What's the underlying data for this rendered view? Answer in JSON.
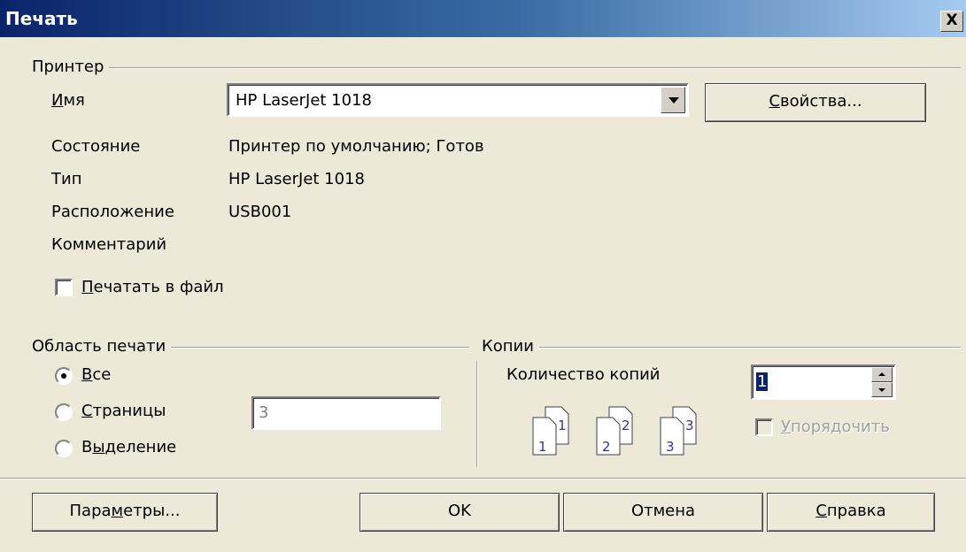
{
  "window": {
    "title": "Печать",
    "close_glyph": "X"
  },
  "printer": {
    "group_label": "Принтер",
    "name_label": "Имя",
    "name_value": "HP LaserJet 1018",
    "properties_button": "Свойства...",
    "status_label": "Состояние",
    "status_value": "Принтер по умолчанию; Готов",
    "type_label": "Тип",
    "type_value": "HP LaserJet 1018",
    "location_label": "Расположение",
    "location_value": "USB001",
    "comment_label": "Комментарий",
    "comment_value": "",
    "print_to_file_label": "Печатать в файл",
    "print_to_file_checked": false
  },
  "print_range": {
    "group_label": "Область печати",
    "options": [
      {
        "label": "Все",
        "selected": true
      },
      {
        "label": "Страницы",
        "selected": false
      },
      {
        "label": "Выделение",
        "selected": false
      }
    ],
    "pages_value": "3"
  },
  "copies": {
    "group_label": "Копии",
    "count_label": "Количество копий",
    "count_value": "1",
    "collate_label": "Упорядочить",
    "collate_enabled": false,
    "collate_pages": [
      "1",
      "2",
      "3"
    ]
  },
  "buttons": {
    "options": "Параметры...",
    "ok": "OK",
    "cancel": "Отмена",
    "help": "Справка"
  },
  "colors": {
    "dialog_bg": "#ece9d8",
    "title_gradient_start": "#0a246a",
    "title_gradient_end": "#a6caf0",
    "selection": "#0a246a",
    "page_digit": "#3030b0"
  },
  "icons": {
    "dropdown": "chevron-down-icon",
    "spin_up": "arrow-up-icon",
    "spin_down": "arrow-down-icon",
    "collate": "collated-pages-icon"
  }
}
